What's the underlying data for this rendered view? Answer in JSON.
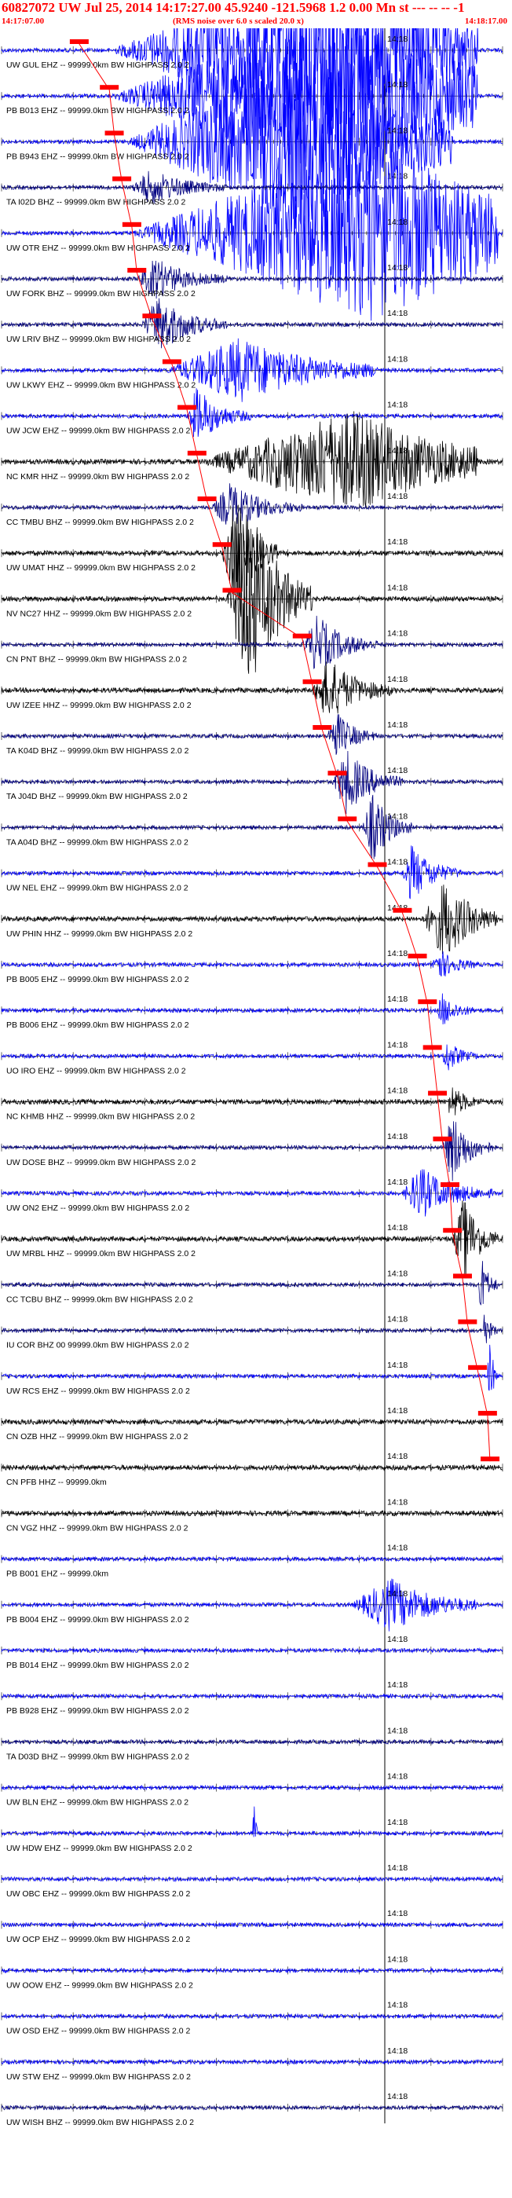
{
  "header": {
    "event_line": "60827072 UW Jul 25, 2014 14:17:27.00   45.9240 -121.5968  1.2 0.00 Mn st --- -- --   -1",
    "start_time": "14:17:07.00",
    "noise_note": "(RMS noise over 6.0 s scaled 20.0 x)",
    "end_time": "14:18:17.00"
  },
  "colors": {
    "pick_red": "#ff0000",
    "trace_blue": "#0000ff",
    "trace_navy": "#000080",
    "trace_black": "#000000",
    "axis_black": "#000000"
  },
  "chart_data": {
    "type": "line",
    "title": "60827072 UW Jul 25, 2014 14:17:27.00",
    "x_range": [
      "14:17:07.00",
      "14:18:17.00"
    ],
    "x_marker_label": "14:18",
    "grid": false,
    "channels": [
      {
        "label": "UW GUL EHZ -- 99999.0km BW  HIGHPASS  2.0  2",
        "color": "#0000ff",
        "burst": [
          0.22,
          0.95,
          6.0,
          0.6
        ]
      },
      {
        "label": "PB B013 EHZ -- 99999.0km BW  HIGHPASS  2.0  2",
        "color": "#0000ff",
        "burst": [
          0.22,
          0.95,
          6.0,
          0.65
        ]
      },
      {
        "label": "PB B943 EHZ -- 99999.0km BW  HIGHPASS  2.0  2",
        "color": "#0000ff",
        "burst": [
          0.25,
          0.9,
          6.0,
          0.55
        ]
      },
      {
        "label": "TA I02D BHZ -- 99999.0km BW  HIGHPASS  2.0  2",
        "color": "#000080",
        "burst": [
          0.26,
          0.45,
          1.2,
          0.2
        ]
      },
      {
        "label": "UW OTR EHZ -- 99999.0km BW  HIGHPASS  2.0  2",
        "color": "#0000ff",
        "burst": [
          0.26,
          0.99,
          6.5,
          0.7
        ]
      },
      {
        "label": "UW FORK BHZ -- 99999.0km BW  HIGHPASS  2.0  2",
        "color": "#000080",
        "burst": [
          0.27,
          0.45,
          1.4,
          0.2
        ]
      },
      {
        "label": "UW LRIV BHZ -- 99999.0km BW  HIGHPASS  2.0  2",
        "color": "#000080",
        "burst": [
          0.28,
          0.45,
          2.0,
          0.2
        ]
      },
      {
        "label": "UW LKWY EHZ -- 99999.0km BW  HIGHPASS  2.0  2",
        "color": "#0000ff",
        "burst": [
          0.33,
          0.75,
          2.2,
          0.35
        ]
      },
      {
        "label": "UW JCW EHZ -- 99999.0km BW  HIGHPASS  2.0  2",
        "color": "#0000ff",
        "burst": [
          0.37,
          0.5,
          2.0,
          0.15
        ]
      },
      {
        "label": "NC KMR HHZ -- 99999.0km BW  HIGHPASS  2.0  2",
        "color": "#000000",
        "burst": [
          0.4,
          0.95,
          3.5,
          0.55
        ]
      },
      {
        "label": "CC TMBU BHZ -- 99999.0km BW  HIGHPASS  2.0  2",
        "color": "#000080",
        "burst": [
          0.42,
          0.6,
          1.6,
          0.2
        ]
      },
      {
        "label": "UW UMAT HHZ -- 99999.0km BW  HIGHPASS  2.0  2",
        "color": "#000000",
        "burst": [
          0.44,
          0.55,
          4.0,
          0.25
        ]
      },
      {
        "label": "NV NC27 HHZ -- 99999.0km BW  HIGHPASS  2.0  2",
        "color": "#000000",
        "burst": [
          0.45,
          0.62,
          7.0,
          0.25
        ]
      },
      {
        "label": "CN PNT BHZ -- 99999.0km BW  HIGHPASS  2.0  2",
        "color": "#000080",
        "burst": [
          0.6,
          0.75,
          2.0,
          0.2
        ]
      },
      {
        "label": "UW IZEE HHZ -- 99999.0km BW  HIGHPASS  2.0  2",
        "color": "#000000",
        "burst": [
          0.62,
          0.78,
          2.2,
          0.2
        ]
      },
      {
        "label": "TA K04D BHZ -- 99999.0km BW  HIGHPASS  2.0  2",
        "color": "#000080",
        "burst": [
          0.65,
          0.75,
          1.8,
          0.15
        ]
      },
      {
        "label": "TA J04D BHZ -- 99999.0km BW  HIGHPASS  2.0  2",
        "color": "#000080",
        "burst": [
          0.66,
          0.8,
          2.2,
          0.2
        ]
      },
      {
        "label": "TA A04D BHZ -- 99999.0km BW  HIGHPASS  2.0  2",
        "color": "#000080",
        "burst": [
          0.72,
          0.82,
          2.4,
          0.2
        ]
      },
      {
        "label": "UW NEL EHZ -- 99999.0km BW  HIGHPASS  2.0  2",
        "color": "#0000ff",
        "burst": [
          0.8,
          0.92,
          2.0,
          0.15
        ]
      },
      {
        "label": "UW PHIN HHZ -- 99999.0km BW  HIGHPASS  2.0  2",
        "color": "#000000",
        "burst": [
          0.84,
          0.99,
          2.8,
          0.3
        ]
      },
      {
        "label": "PB B005 EHZ -- 99999.0km BW  HIGHPASS  2.0  2",
        "color": "#0000ff",
        "burst": [
          0.86,
          0.95,
          1.2,
          0.1
        ]
      },
      {
        "label": "PB B006 EHZ -- 99999.0km BW  HIGHPASS  2.0  2",
        "color": "#0000ff",
        "burst": [
          0.87,
          0.95,
          1.2,
          0.1
        ]
      },
      {
        "label": "UO IRO EHZ -- 99999.0km BW  HIGHPASS  2.0  2",
        "color": "#0000ff",
        "burst": [
          0.88,
          0.95,
          1.2,
          0.1
        ]
      },
      {
        "label": "NC KHMB HHZ -- 99999.0km BW  HIGHPASS  2.0  2",
        "color": "#000000",
        "burst": [
          0.89,
          0.96,
          1.3,
          0.1
        ]
      },
      {
        "label": "UW DOSE BHZ -- 99999.0km BW  HIGHPASS  2.0  2",
        "color": "#000080",
        "burst": [
          0.88,
          0.98,
          2.4,
          0.2
        ]
      },
      {
        "label": "UW ON2 EHZ -- 99999.0km BW  HIGHPASS  2.0  2",
        "color": "#0000ff",
        "burst": [
          0.8,
          0.98,
          1.8,
          0.2
        ]
      },
      {
        "label": "UW MRBL HHZ -- 99999.0km BW  HIGHPASS  2.0  2",
        "color": "#000000",
        "burst": [
          0.9,
          0.99,
          3.0,
          0.25
        ]
      },
      {
        "label": "CC TCBU BHZ -- 99999.0km BW  HIGHPASS  2.0  2",
        "color": "#000080",
        "burst": [
          0.95,
          0.99,
          2.0,
          0.2
        ]
      },
      {
        "label": "IU COR BHZ 00 99999.0km BW  HIGHPASS  2.0  2",
        "color": "#000080",
        "burst": [
          0.96,
          0.99,
          1.5,
          0.1
        ]
      },
      {
        "label": "UW RCS EHZ -- 99999.0km BW  HIGHPASS  2.0  2",
        "color": "#0000ff",
        "burst": [
          0.97,
          0.99,
          3.0,
          0.2
        ]
      },
      {
        "label": "CN OZB HHZ -- 99999.0km BW  HIGHPASS  2.0  2",
        "color": "#000000",
        "burst": [
          0,
          0,
          1,
          0
        ]
      },
      {
        "label": "CN PFB HHZ -- 99999.0km",
        "color": "#000000",
        "burst": [
          0,
          0,
          1,
          0
        ]
      },
      {
        "label": "CN VGZ HHZ -- 99999.0km BW  HIGHPASS  2.0  2",
        "color": "#000000",
        "burst": [
          0,
          0,
          1,
          0
        ]
      },
      {
        "label": "PB B001 EHZ -- 99999.0km",
        "color": "#0000ff",
        "burst": [
          0,
          0,
          1,
          0
        ]
      },
      {
        "label": "PB B004 EHZ -- 99999.0km BW  HIGHPASS  2.0  2",
        "color": "#0000ff",
        "burst": [
          0.7,
          0.95,
          1.8,
          0.3
        ]
      },
      {
        "label": "PB B014 EHZ -- 99999.0km BW  HIGHPASS  2.0  2",
        "color": "#0000ff",
        "burst": [
          0,
          0,
          1,
          0
        ]
      },
      {
        "label": "PB B928 EHZ -- 99999.0km BW  HIGHPASS  2.0  2",
        "color": "#0000ff",
        "burst": [
          0,
          0,
          1,
          0
        ]
      },
      {
        "label": "TA D03D BHZ -- 99999.0km BW  HIGHPASS  2.0  2",
        "color": "#000080",
        "burst": [
          0,
          0,
          1,
          0
        ]
      },
      {
        "label": "UW BLN EHZ -- 99999.0km BW  HIGHPASS  2.0  2",
        "color": "#0000ff",
        "burst": [
          0,
          0,
          1,
          0
        ]
      },
      {
        "label": "UW HDW EHZ -- 99999.0km BW  HIGHPASS  2.0  2",
        "color": "#0000ff",
        "burst": [
          0.5,
          0.51,
          3.0,
          0.3
        ]
      },
      {
        "label": "UW OBC EHZ -- 99999.0km BW  HIGHPASS  2.0  2",
        "color": "#0000ff",
        "burst": [
          0,
          0,
          1,
          0
        ]
      },
      {
        "label": "UW OCP EHZ -- 99999.0km BW  HIGHPASS  2.0  2",
        "color": "#0000ff",
        "burst": [
          0,
          0,
          1,
          0
        ]
      },
      {
        "label": "UW OOW EHZ -- 99999.0km BW  HIGHPASS  2.0  2",
        "color": "#0000ff",
        "burst": [
          0,
          0,
          1,
          0
        ]
      },
      {
        "label": "UW OSD EHZ -- 99999.0km BW  HIGHPASS  2.0  2",
        "color": "#0000ff",
        "burst": [
          0,
          0,
          1,
          0
        ]
      },
      {
        "label": "UW STW EHZ -- 99999.0km BW  HIGHPASS  2.0  2",
        "color": "#0000ff",
        "burst": [
          0,
          0,
          1,
          0
        ]
      },
      {
        "label": "UW WISH BHZ -- 99999.0km BW  HIGHPASS  2.0  2",
        "color": "#000080",
        "burst": [
          0,
          0,
          1,
          0
        ]
      }
    ],
    "pick_time_fractions": [
      0.155,
      0.215,
      0.225,
      0.24,
      0.26,
      0.27,
      0.3,
      0.34,
      0.37,
      0.39,
      0.41,
      0.44,
      0.46,
      0.6,
      0.62,
      0.64,
      0.67,
      0.69,
      0.75,
      0.8,
      0.83,
      0.85,
      0.86,
      0.87,
      0.88,
      0.895,
      0.9,
      0.92,
      0.93,
      0.95,
      0.97,
      0.975
    ]
  }
}
